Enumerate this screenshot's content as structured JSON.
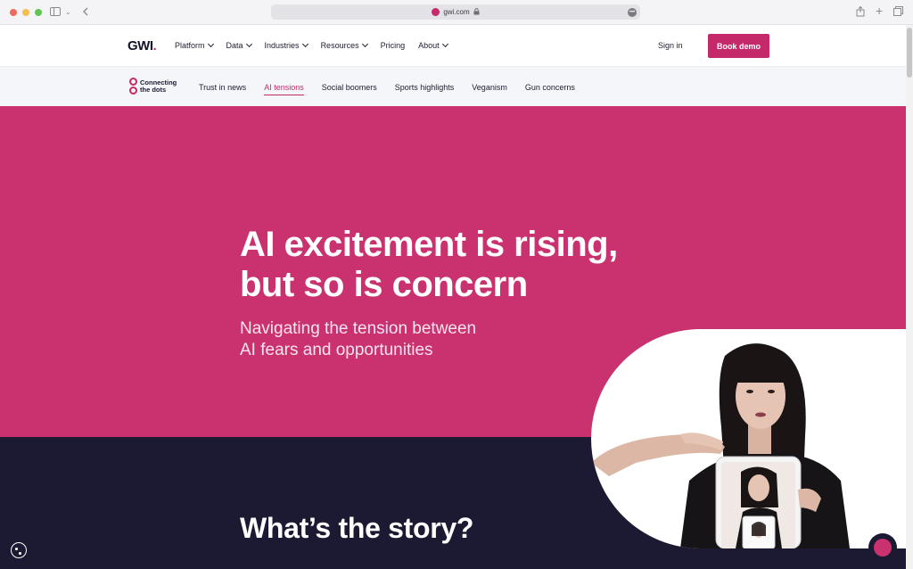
{
  "browser": {
    "url": "gwi.com",
    "colors": {
      "favicon": "#c42a6a"
    }
  },
  "nav": {
    "logo_text": "GWI",
    "logo_dot": ".",
    "items": [
      {
        "label": "Platform",
        "has_dropdown": true
      },
      {
        "label": "Data",
        "has_dropdown": true
      },
      {
        "label": "Industries",
        "has_dropdown": true
      },
      {
        "label": "Resources",
        "has_dropdown": true
      },
      {
        "label": "Pricing",
        "has_dropdown": false
      },
      {
        "label": "About",
        "has_dropdown": true
      }
    ],
    "signin_label": "Sign in",
    "cta_label": "Book demo"
  },
  "subnav": {
    "brand_line1": "Connecting",
    "brand_line2": "the dots",
    "items": [
      {
        "label": "Trust in news",
        "active": false
      },
      {
        "label": "AI tensions",
        "active": true
      },
      {
        "label": "Social boomers",
        "active": false
      },
      {
        "label": "Sports highlights",
        "active": false
      },
      {
        "label": "Veganism",
        "active": false
      },
      {
        "label": "Gun concerns",
        "active": false
      }
    ]
  },
  "hero": {
    "title_line1": "AI excitement is rising,",
    "title_line2": "but so is concern",
    "subtitle_line1": "Navigating the tension between",
    "subtitle_line2": "AI fears and opportunities"
  },
  "section": {
    "heading": "What’s the story?"
  },
  "colors": {
    "brand_pink": "#c9326f",
    "dark_navy": "#1c1932",
    "cta": "#c42a6a"
  },
  "icons": [
    "sidebar-icon",
    "back-icon",
    "lock-icon",
    "more-icon",
    "share-icon",
    "new-tab-icon",
    "tabs-icon",
    "cookie-icon",
    "chat-icon"
  ]
}
